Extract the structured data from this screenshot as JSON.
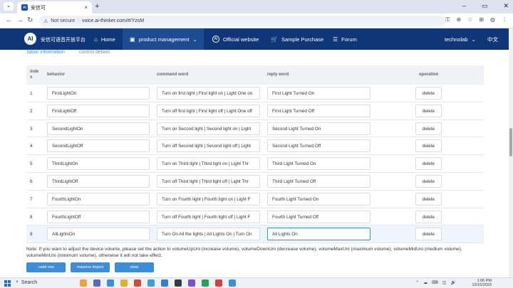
{
  "browser": {
    "tab_title": "安信可",
    "tab_icon_text": "AI",
    "new_tab": "+",
    "tab_close": "×",
    "tab_menu": "⌄",
    "win_minimize": "–",
    "win_restore": "▭",
    "win_close": "✕",
    "back": "←",
    "forward": "→",
    "reload": "↻",
    "security_label": "Not secure",
    "url": "voice.ai-thinker.com/#/YzsM",
    "toolbar_icons": [
      "⚿",
      "⊕",
      "☆",
      "⊞",
      "◍",
      "⋮"
    ]
  },
  "sitenav": {
    "logo_text": "AI",
    "brand": "安信可语音开放平台",
    "home": "Home",
    "product_management": "product management",
    "official_website": "Official website",
    "sample_purchase": "Sample Purchase",
    "forum": "Forum",
    "user": "technolab",
    "language": "中文",
    "dropdown_caret": "⌄"
  },
  "subtabs": {
    "basic_information": "basic information",
    "control_details": "control details"
  },
  "table": {
    "headers": {
      "index": "inde x",
      "behavior": "behavior",
      "command_word": "command word",
      "reply_word": "reply word",
      "operation": "operation"
    },
    "rows": [
      {
        "index": "1",
        "behavior": "FirstLightOn",
        "command": "Turn on first light | First light on | Light One on",
        "reply": "First Light Turned On",
        "action": "delete"
      },
      {
        "index": "2",
        "behavior": "FirstLightOff",
        "command": "Turn off first light | First light off | Light One off",
        "reply": "First Light Turned Off",
        "action": "delete"
      },
      {
        "index": "3",
        "behavior": "SecondLightOn",
        "command": "Turn on Second light | Second light on | Light",
        "reply": "Second Light Turned On",
        "action": "delete"
      },
      {
        "index": "4",
        "behavior": "SecondLightOff",
        "command": "Turn off Second light | Second light off | Light",
        "reply": "Second Light Turned Off",
        "action": "delete"
      },
      {
        "index": "5",
        "behavior": "ThirdLightOn",
        "command": "Turn on Third light | Third light on | Light Thr",
        "reply": "Third  Light Turned On",
        "action": "delete"
      },
      {
        "index": "6",
        "behavior": "ThirdLightOff",
        "command": "Turn off Third light | Third light off | Light Thr",
        "reply": "Third  Light Turned Off",
        "action": "delete"
      },
      {
        "index": "7",
        "behavior": "FourthLightOn",
        "command": "Turn on Fourth light | Fourth light on | Light F",
        "reply": "Fourth Light Turned On",
        "action": "delete"
      },
      {
        "index": "8",
        "behavior": "FourthLightOff",
        "command": "Turn off Fourth light | Fourth light off | Light F",
        "reply": "Fourth Light Turned Off",
        "action": "delete"
      },
      {
        "index": "9",
        "behavior": "AllLightsOn",
        "command": "Turn On All the lights | All Lights On | Turn On",
        "reply": "All Lights On",
        "action": "delete"
      }
    ]
  },
  "note": "Note: If you want to adjust the device volume, please set the action to volumeUpUni (increase volume), volumeDownUni (decrease volume), volumeMaxUni (maximum volume), volumeMidUni (medium volume), volumeMinUni (minimum volume), otherwise it will not take effect.",
  "buttons": {
    "add_one": "+add one",
    "massive_import": "massive import",
    "clear": "clear"
  },
  "taskbar": {
    "search": "Search",
    "search_icon": "⌕",
    "time": "1:06 PM",
    "date": "12/15/2023",
    "tray_icons": [
      "⌃",
      "☁",
      "⌨",
      "◫",
      "🔊"
    ],
    "app_colors": [
      "#e8a33a",
      "#5d6bbf",
      "#3b8fd9",
      "#e0b12f",
      "#d04a3a",
      "#3aa0d9",
      "#2f7fd0",
      "#3a3a3a",
      "#7a4fd0",
      "#25a55a",
      "#d0453a",
      "#3b8fd9"
    ]
  }
}
